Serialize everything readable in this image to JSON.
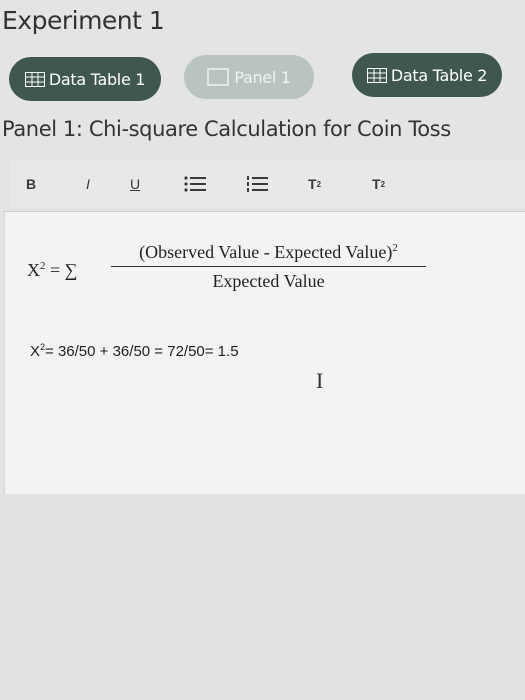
{
  "header": {
    "title": "Experiment 1"
  },
  "tabs": [
    {
      "label": "Data Table 1",
      "icon": "table-icon",
      "active": false
    },
    {
      "label": "Panel 1",
      "icon": "panel-icon",
      "active": true
    },
    {
      "label": "Data Table 2",
      "icon": "table-icon",
      "active": false
    }
  ],
  "section": {
    "title": "Panel 1: Chi-square Calculation for Coin Toss"
  },
  "toolbar": {
    "bold_label": "B",
    "italic_label": "I",
    "underline_label": "U",
    "superscript_label": "T",
    "superscript_mark": "2",
    "subscript_label": "T",
    "subscript_mark": "2"
  },
  "editor": {
    "formula_lhs": "X",
    "formula_lhs_exp": "2",
    "formula_equals_sum": " = ∑",
    "numerator": "(Observed Value - Expected Value)",
    "numerator_exp": "2",
    "denominator": "Expected Value",
    "calc_var": "X",
    "calc_exp": "2",
    "calc_text": "= 36/50 + 36/50 = 72/50= 1.5"
  },
  "colors": {
    "tab_bg": "#3f5651",
    "tab_active_bg": "#b9c3c0",
    "page_bg": "#e4e5e3",
    "editor_bg": "#f3f3f3"
  }
}
